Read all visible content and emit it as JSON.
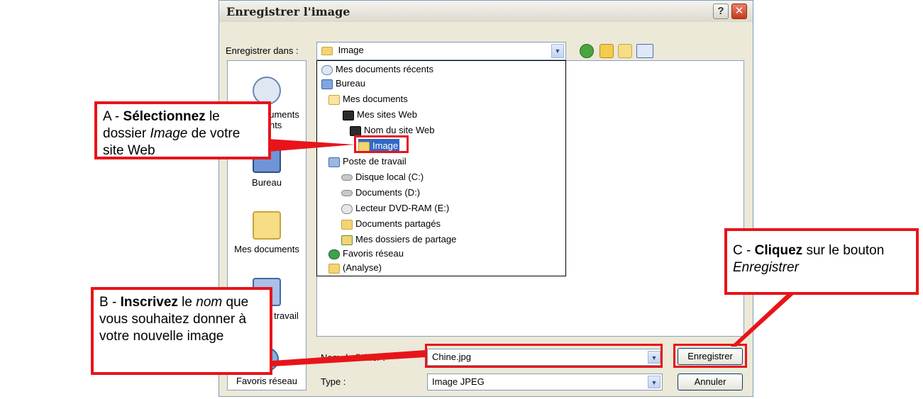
{
  "window": {
    "title": "Enregistrer l'image"
  },
  "toolbar": {
    "save_in_label": "Enregistrer dans :",
    "save_in_value": "Image"
  },
  "places": [
    "Mes documents récents",
    "Bureau",
    "Mes documents",
    "Poste de travail",
    "Favoris réseau"
  ],
  "dropdown": [
    "Mes documents récents",
    "Bureau",
    "Mes documents",
    "Mes sites Web",
    "Nom du site Web",
    "Image",
    "Poste de travail",
    "Disque local (C:)",
    "Documents (D:)",
    "Lecteur DVD-RAM (E:)",
    "Documents partagés",
    "Mes dossiers de partage",
    "Favoris réseau",
    "(Analyse)"
  ],
  "form": {
    "filename_label": "Nom du fichier :",
    "filename_value": "Chine.jpg",
    "type_label": "Type :",
    "type_value": "Image JPEG",
    "save_button": "Enregistrer",
    "cancel_button": "Annuler"
  },
  "callouts": {
    "a_prefix": "A - ",
    "a_bold": "Sélectionnez",
    "a_mid": " le dossier ",
    "a_italic": "Image",
    "a_end": " de votre site Web",
    "b_prefix": "B - ",
    "b_bold": "Inscrivez",
    "b_mid": " le ",
    "b_italic": "nom",
    "b_end": " que vous souhaitez donner à votre nouvelle image",
    "c_prefix": "C - ",
    "c_bold": "Cliquez",
    "c_mid": " sur le bouton ",
    "c_italic": "Enregistrer"
  },
  "colors": {
    "annotation_red": "#e8141a",
    "dialog_bg": "#ece9d8",
    "border_blue": "#7f9db9"
  }
}
